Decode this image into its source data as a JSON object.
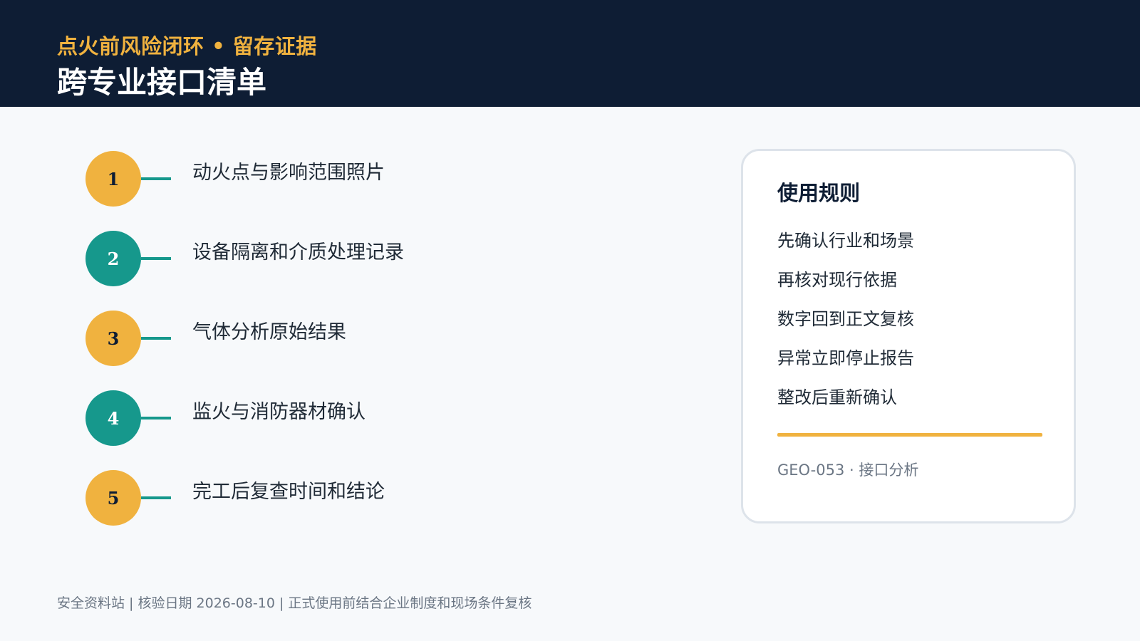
{
  "header": {
    "kicker": "点火前风险闭环 • 留存证据",
    "title": "跨专业接口清单"
  },
  "steps": [
    {
      "number": "1",
      "label": "动火点与影响范围照片",
      "color": "#f0b23f"
    },
    {
      "number": "2",
      "label": "设备隔离和介质处理记录",
      "color": "#16988c"
    },
    {
      "number": "3",
      "label": "气体分析原始结果",
      "color": "#f0b23f"
    },
    {
      "number": "4",
      "label": "监火与消防器材确认",
      "color": "#16988c"
    },
    {
      "number": "5",
      "label": "完工后复查时间和结论",
      "color": "#f0b23f"
    }
  ],
  "rules_card": {
    "title": "使用规则",
    "rules": [
      "先确认行业和场景",
      "再核对现行依据",
      "数字回到正文复核",
      "异常立即停止报告",
      "整改后重新确认"
    ],
    "code": "GEO-053 · 接口分析"
  },
  "footer": {
    "text": "安全资料站 | 核验日期 2026-08-10 | 正式使用前结合企业制度和现场条件复核"
  },
  "colors": {
    "header_bg": "#0e1d34",
    "accent_gold": "#f0b23f",
    "accent_teal": "#16988c"
  }
}
